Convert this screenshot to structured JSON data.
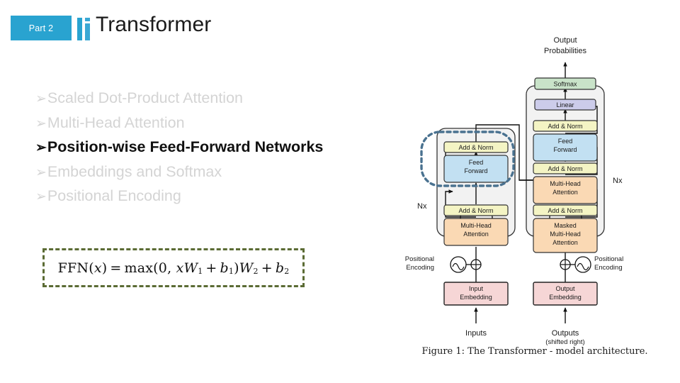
{
  "header": {
    "part_label": "Part 2",
    "title": "Transformer",
    "accent_color": "#29a3d0",
    "logo_icon": "bar-chart-logo-icon"
  },
  "bullets": [
    {
      "marker": "➢",
      "text": "Scaled Dot-Product Attention",
      "active": false
    },
    {
      "marker": "➢",
      "text": "Multi-Head Attention",
      "active": false
    },
    {
      "marker": "➢",
      "text": "Position-wise Feed-Forward Networks",
      "active": true
    },
    {
      "marker": "➢",
      "text": "Embeddings and Softmax",
      "active": false
    },
    {
      "marker": "➢",
      "text": "Positional Encoding",
      "active": false
    }
  ],
  "formula": {
    "plain": "FFN(x) = max(0, xW1 + b1)W2 + b2",
    "fn_name": "FFN",
    "arg": "x",
    "equals": "=",
    "max_name": "max",
    "zero": "0",
    "w1": "W",
    "w1_sub": "1",
    "b1": "b",
    "b1_sub": "1",
    "w2": "W",
    "w2_sub": "2",
    "b2": "b",
    "b2_sub": "2",
    "border_color": "#5b6b34",
    "border_style": "dashed"
  },
  "figure": {
    "caption": "Figure 1: The Transformer - model architecture.",
    "top_label_line1": "Output",
    "top_label_line2": "Probabilities",
    "encoder_repeat": "Nx",
    "decoder_repeat": "Nx",
    "highlight_color": "#4a7290",
    "highlight_target": "encoder Add & Norm + Feed Forward",
    "boxes": {
      "softmax": {
        "label": "Softmax",
        "color": "#c9e3c9"
      },
      "linear": {
        "label": "Linear",
        "color": "#ccccea"
      },
      "add_norm": {
        "label": "Add & Norm",
        "color": "#f4f4c4"
      },
      "feed_forward_l1": "Feed",
      "feed_forward_l2": "Forward",
      "feed_forward_color": "#c2e0f2",
      "multi_head_l1": "Multi-Head",
      "multi_head_l2": "Attention",
      "attention_color": "#fad9b4",
      "masked_l1": "Masked",
      "masked_l2": "Multi-Head",
      "masked_l3": "Attention",
      "input_embedding_l1": "Input",
      "input_embedding_l2": "Embedding",
      "output_embedding_l1": "Output",
      "output_embedding_l2": "Embedding",
      "embedding_color": "#f6d6d6"
    },
    "positional_encoding_left_l1": "Positional",
    "positional_encoding_left_l2": "Encoding",
    "positional_encoding_right_l1": "Positional",
    "positional_encoding_right_l2": "Encoding",
    "inputs_label": "Inputs",
    "outputs_label": "Outputs",
    "outputs_sub_label": "(shifted right)",
    "add_symbol": "⊕"
  }
}
